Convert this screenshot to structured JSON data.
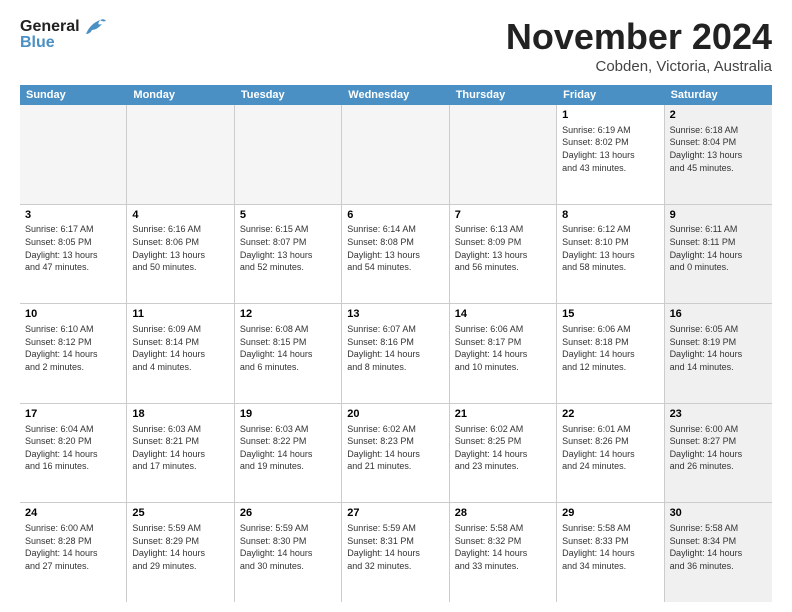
{
  "header": {
    "logo_general": "General",
    "logo_blue": "Blue",
    "month_title": "November 2024",
    "location": "Cobden, Victoria, Australia"
  },
  "weekdays": [
    "Sunday",
    "Monday",
    "Tuesday",
    "Wednesday",
    "Thursday",
    "Friday",
    "Saturday"
  ],
  "weeks": [
    [
      {
        "day": "",
        "info": "",
        "empty": true
      },
      {
        "day": "",
        "info": "",
        "empty": true
      },
      {
        "day": "",
        "info": "",
        "empty": true
      },
      {
        "day": "",
        "info": "",
        "empty": true
      },
      {
        "day": "",
        "info": "",
        "empty": true
      },
      {
        "day": "1",
        "info": "Sunrise: 6:19 AM\nSunset: 8:02 PM\nDaylight: 13 hours\nand 43 minutes."
      },
      {
        "day": "2",
        "info": "Sunrise: 6:18 AM\nSunset: 8:04 PM\nDaylight: 13 hours\nand 45 minutes.",
        "saturday": true
      }
    ],
    [
      {
        "day": "3",
        "info": "Sunrise: 6:17 AM\nSunset: 8:05 PM\nDaylight: 13 hours\nand 47 minutes."
      },
      {
        "day": "4",
        "info": "Sunrise: 6:16 AM\nSunset: 8:06 PM\nDaylight: 13 hours\nand 50 minutes."
      },
      {
        "day": "5",
        "info": "Sunrise: 6:15 AM\nSunset: 8:07 PM\nDaylight: 13 hours\nand 52 minutes."
      },
      {
        "day": "6",
        "info": "Sunrise: 6:14 AM\nSunset: 8:08 PM\nDaylight: 13 hours\nand 54 minutes."
      },
      {
        "day": "7",
        "info": "Sunrise: 6:13 AM\nSunset: 8:09 PM\nDaylight: 13 hours\nand 56 minutes."
      },
      {
        "day": "8",
        "info": "Sunrise: 6:12 AM\nSunset: 8:10 PM\nDaylight: 13 hours\nand 58 minutes."
      },
      {
        "day": "9",
        "info": "Sunrise: 6:11 AM\nSunset: 8:11 PM\nDaylight: 14 hours\nand 0 minutes.",
        "saturday": true
      }
    ],
    [
      {
        "day": "10",
        "info": "Sunrise: 6:10 AM\nSunset: 8:12 PM\nDaylight: 14 hours\nand 2 minutes."
      },
      {
        "day": "11",
        "info": "Sunrise: 6:09 AM\nSunset: 8:14 PM\nDaylight: 14 hours\nand 4 minutes."
      },
      {
        "day": "12",
        "info": "Sunrise: 6:08 AM\nSunset: 8:15 PM\nDaylight: 14 hours\nand 6 minutes."
      },
      {
        "day": "13",
        "info": "Sunrise: 6:07 AM\nSunset: 8:16 PM\nDaylight: 14 hours\nand 8 minutes."
      },
      {
        "day": "14",
        "info": "Sunrise: 6:06 AM\nSunset: 8:17 PM\nDaylight: 14 hours\nand 10 minutes."
      },
      {
        "day": "15",
        "info": "Sunrise: 6:06 AM\nSunset: 8:18 PM\nDaylight: 14 hours\nand 12 minutes."
      },
      {
        "day": "16",
        "info": "Sunrise: 6:05 AM\nSunset: 8:19 PM\nDaylight: 14 hours\nand 14 minutes.",
        "saturday": true
      }
    ],
    [
      {
        "day": "17",
        "info": "Sunrise: 6:04 AM\nSunset: 8:20 PM\nDaylight: 14 hours\nand 16 minutes."
      },
      {
        "day": "18",
        "info": "Sunrise: 6:03 AM\nSunset: 8:21 PM\nDaylight: 14 hours\nand 17 minutes."
      },
      {
        "day": "19",
        "info": "Sunrise: 6:03 AM\nSunset: 8:22 PM\nDaylight: 14 hours\nand 19 minutes."
      },
      {
        "day": "20",
        "info": "Sunrise: 6:02 AM\nSunset: 8:23 PM\nDaylight: 14 hours\nand 21 minutes."
      },
      {
        "day": "21",
        "info": "Sunrise: 6:02 AM\nSunset: 8:25 PM\nDaylight: 14 hours\nand 23 minutes."
      },
      {
        "day": "22",
        "info": "Sunrise: 6:01 AM\nSunset: 8:26 PM\nDaylight: 14 hours\nand 24 minutes."
      },
      {
        "day": "23",
        "info": "Sunrise: 6:00 AM\nSunset: 8:27 PM\nDaylight: 14 hours\nand 26 minutes.",
        "saturday": true
      }
    ],
    [
      {
        "day": "24",
        "info": "Sunrise: 6:00 AM\nSunset: 8:28 PM\nDaylight: 14 hours\nand 27 minutes."
      },
      {
        "day": "25",
        "info": "Sunrise: 5:59 AM\nSunset: 8:29 PM\nDaylight: 14 hours\nand 29 minutes."
      },
      {
        "day": "26",
        "info": "Sunrise: 5:59 AM\nSunset: 8:30 PM\nDaylight: 14 hours\nand 30 minutes."
      },
      {
        "day": "27",
        "info": "Sunrise: 5:59 AM\nSunset: 8:31 PM\nDaylight: 14 hours\nand 32 minutes."
      },
      {
        "day": "28",
        "info": "Sunrise: 5:58 AM\nSunset: 8:32 PM\nDaylight: 14 hours\nand 33 minutes."
      },
      {
        "day": "29",
        "info": "Sunrise: 5:58 AM\nSunset: 8:33 PM\nDaylight: 14 hours\nand 34 minutes."
      },
      {
        "day": "30",
        "info": "Sunrise: 5:58 AM\nSunset: 8:34 PM\nDaylight: 14 hours\nand 36 minutes.",
        "saturday": true
      }
    ]
  ]
}
